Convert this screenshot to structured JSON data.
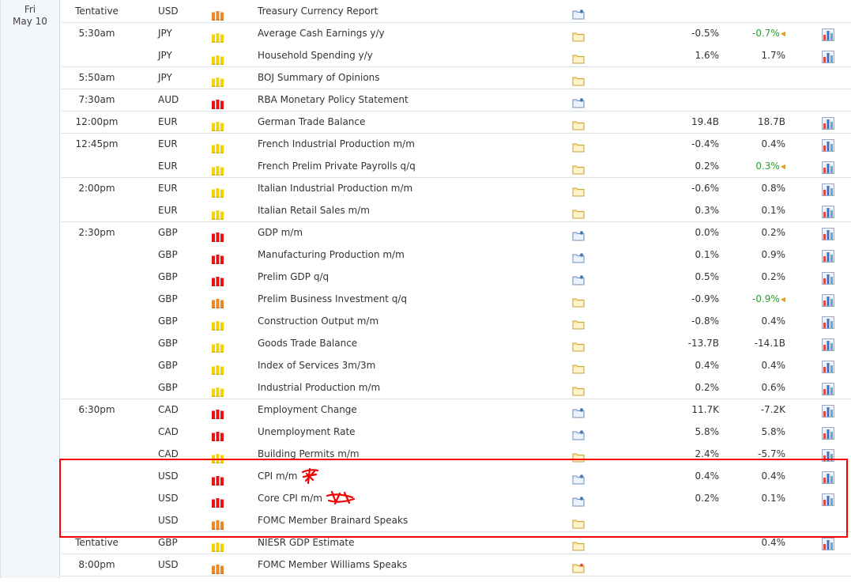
{
  "date": {
    "day": "Fri",
    "date": "May 10"
  },
  "colors": {
    "high": "#ee1111",
    "medium": "#ee8822",
    "low": "#f4d400",
    "up_text": "#2ca02c",
    "highlight_box": "#ff0000"
  },
  "icons": {
    "impact": "impact-bars-icon",
    "details": "event-details-icon",
    "graph": "bar-graph-icon"
  },
  "events": [
    {
      "time": "Tentative",
      "currency": "USD",
      "impact": "medium",
      "event": "Treasury Currency Report",
      "details": "blue",
      "actual": "",
      "forecast": "",
      "forecast_up": false,
      "graph": false
    },
    {
      "time": "5:30am",
      "currency": "JPY",
      "impact": "low",
      "event": "Average Cash Earnings y/y",
      "details": "yellow",
      "actual": "-0.5%",
      "forecast": "-0.7%",
      "forecast_up": true,
      "graph": true
    },
    {
      "time": "",
      "currency": "JPY",
      "impact": "low",
      "event": "Household Spending y/y",
      "details": "yellow",
      "actual": "1.6%",
      "forecast": "1.7%",
      "forecast_up": false,
      "graph": true
    },
    {
      "time": "5:50am",
      "currency": "JPY",
      "impact": "low",
      "event": "BOJ Summary of Opinions",
      "details": "yellow",
      "actual": "",
      "forecast": "",
      "forecast_up": false,
      "graph": false
    },
    {
      "time": "7:30am",
      "currency": "AUD",
      "impact": "high",
      "event": "RBA Monetary Policy Statement",
      "details": "blue",
      "actual": "",
      "forecast": "",
      "forecast_up": false,
      "graph": false
    },
    {
      "time": "12:00pm",
      "currency": "EUR",
      "impact": "low",
      "event": "German Trade Balance",
      "details": "yellow",
      "actual": "19.4B",
      "forecast": "18.7B",
      "forecast_up": false,
      "graph": true
    },
    {
      "time": "12:45pm",
      "currency": "EUR",
      "impact": "low",
      "event": "French Industrial Production m/m",
      "details": "yellow",
      "actual": "-0.4%",
      "forecast": "0.4%",
      "forecast_up": false,
      "graph": true
    },
    {
      "time": "",
      "currency": "EUR",
      "impact": "low",
      "event": "French Prelim Private Payrolls q/q",
      "details": "yellow",
      "actual": "0.2%",
      "forecast": "0.3%",
      "forecast_up": true,
      "graph": true
    },
    {
      "time": "2:00pm",
      "currency": "EUR",
      "impact": "low",
      "event": "Italian Industrial Production m/m",
      "details": "yellow",
      "actual": "-0.6%",
      "forecast": "0.8%",
      "forecast_up": false,
      "graph": true
    },
    {
      "time": "",
      "currency": "EUR",
      "impact": "low",
      "event": "Italian Retail Sales m/m",
      "details": "yellow",
      "actual": "0.3%",
      "forecast": "0.1%",
      "forecast_up": false,
      "graph": true
    },
    {
      "time": "2:30pm",
      "currency": "GBP",
      "impact": "high",
      "event": "GDP m/m",
      "details": "blue",
      "actual": "0.0%",
      "forecast": "0.2%",
      "forecast_up": false,
      "graph": true
    },
    {
      "time": "",
      "currency": "GBP",
      "impact": "high",
      "event": "Manufacturing Production m/m",
      "details": "blue",
      "actual": "0.1%",
      "forecast": "0.9%",
      "forecast_up": false,
      "graph": true
    },
    {
      "time": "",
      "currency": "GBP",
      "impact": "high",
      "event": "Prelim GDP q/q",
      "details": "blue",
      "actual": "0.5%",
      "forecast": "0.2%",
      "forecast_up": false,
      "graph": true
    },
    {
      "time": "",
      "currency": "GBP",
      "impact": "medium",
      "event": "Prelim Business Investment q/q",
      "details": "yellow",
      "actual": "-0.9%",
      "forecast": "-0.9%",
      "forecast_up": true,
      "graph": true
    },
    {
      "time": "",
      "currency": "GBP",
      "impact": "low",
      "event": "Construction Output m/m",
      "details": "yellow",
      "actual": "-0.8%",
      "forecast": "0.4%",
      "forecast_up": false,
      "graph": true
    },
    {
      "time": "",
      "currency": "GBP",
      "impact": "low",
      "event": "Goods Trade Balance",
      "details": "yellow",
      "actual": "-13.7B",
      "forecast": "-14.1B",
      "forecast_up": false,
      "graph": true
    },
    {
      "time": "",
      "currency": "GBP",
      "impact": "low",
      "event": "Index of Services 3m/3m",
      "details": "yellow",
      "actual": "0.4%",
      "forecast": "0.4%",
      "forecast_up": false,
      "graph": true
    },
    {
      "time": "",
      "currency": "GBP",
      "impact": "low",
      "event": "Industrial Production m/m",
      "details": "yellow",
      "actual": "0.2%",
      "forecast": "0.6%",
      "forecast_up": false,
      "graph": true
    },
    {
      "time": "6:30pm",
      "currency": "CAD",
      "impact": "high",
      "event": "Employment Change",
      "details": "blue",
      "actual": "11.7K",
      "forecast": "-7.2K",
      "forecast_up": false,
      "graph": true
    },
    {
      "time": "",
      "currency": "CAD",
      "impact": "high",
      "event": "Unemployment Rate",
      "details": "blue",
      "actual": "5.8%",
      "forecast": "5.8%",
      "forecast_up": false,
      "graph": true
    },
    {
      "time": "",
      "currency": "CAD",
      "impact": "low",
      "event": "Building Permits m/m",
      "details": "yellow",
      "actual": "2.4%",
      "forecast": "-5.7%",
      "forecast_up": false,
      "graph": true
    },
    {
      "time": "",
      "currency": "USD",
      "impact": "high",
      "event": "CPI m/m",
      "details": "blue",
      "actual": "0.4%",
      "forecast": "0.4%",
      "forecast_up": false,
      "graph": true,
      "marker": true
    },
    {
      "time": "",
      "currency": "USD",
      "impact": "high",
      "event": "Core CPI m/m",
      "details": "blue",
      "actual": "0.2%",
      "forecast": "0.1%",
      "forecast_up": false,
      "graph": true,
      "marker": true
    },
    {
      "time": "",
      "currency": "USD",
      "impact": "medium",
      "event": "FOMC Member Brainard Speaks",
      "details": "yellow",
      "actual": "",
      "forecast": "",
      "forecast_up": false,
      "graph": false
    },
    {
      "time": "Tentative",
      "currency": "GBP",
      "impact": "low",
      "event": "NIESR GDP Estimate",
      "details": "yellow",
      "actual": "",
      "forecast": "0.4%",
      "forecast_up": false,
      "graph": true
    },
    {
      "time": "8:00pm",
      "currency": "USD",
      "impact": "medium",
      "event": "FOMC Member Williams Speaks",
      "details": "star",
      "actual": "",
      "forecast": "",
      "forecast_up": false,
      "graph": false
    }
  ]
}
